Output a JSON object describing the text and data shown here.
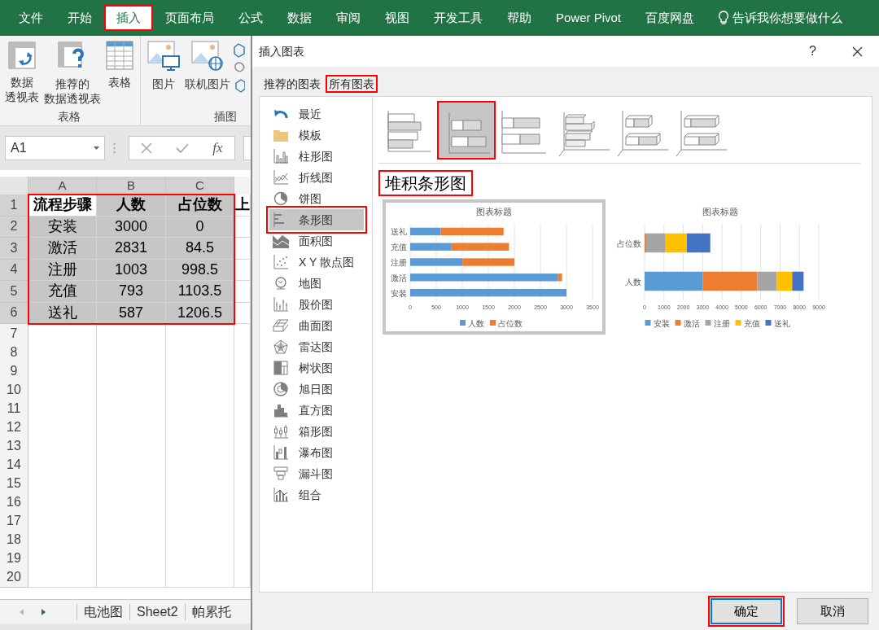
{
  "menu_tabs": [
    {
      "label": "文件",
      "selected": false
    },
    {
      "label": "开始",
      "selected": false
    },
    {
      "label": "插入",
      "selected": true
    },
    {
      "label": "页面布局",
      "selected": false
    },
    {
      "label": "公式",
      "selected": false
    },
    {
      "label": "数据",
      "selected": false
    },
    {
      "label": "审阅",
      "selected": false
    },
    {
      "label": "视图",
      "selected": false
    },
    {
      "label": "开发工具",
      "selected": false
    },
    {
      "label": "帮助",
      "selected": false
    },
    {
      "label": "Power Pivot",
      "selected": false
    },
    {
      "label": "百度网盘",
      "selected": false
    }
  ],
  "tell_me": "告诉我你想要做什么",
  "ribbon_groups": [
    {
      "label": "表格",
      "buttons": [
        {
          "lines": [
            "数据",
            "透视表"
          ]
        },
        {
          "lines": [
            "推荐的",
            "数据透视表"
          ]
        },
        {
          "lines": [
            "表格"
          ]
        }
      ]
    },
    {
      "label": "插图",
      "buttons": [
        {
          "lines": [
            "图片"
          ]
        },
        {
          "lines": [
            "联机图片"
          ]
        }
      ]
    }
  ],
  "name_box": "A1",
  "formula_fx": "fx",
  "columns": [
    {
      "label": "A",
      "selected": true
    },
    {
      "label": "B",
      "selected": true
    },
    {
      "label": "C",
      "selected": true
    }
  ],
  "rows": [
    {
      "number": "1",
      "selected": true,
      "header": true,
      "cells": [
        {
          "text": "流程步骤",
          "selected": false
        },
        {
          "text": "人数",
          "selected": true
        },
        {
          "text": "占位数",
          "selected": true
        },
        {
          "text": "上",
          "selected": false
        }
      ]
    },
    {
      "number": "2",
      "selected": true,
      "header": false,
      "cells": [
        {
          "text": "安装",
          "selected": true
        },
        {
          "text": "3000",
          "selected": true
        },
        {
          "text": "0",
          "selected": true
        }
      ]
    },
    {
      "number": "3",
      "selected": true,
      "header": false,
      "cells": [
        {
          "text": "激活",
          "selected": true
        },
        {
          "text": "2831",
          "selected": true
        },
        {
          "text": "84.5",
          "selected": true
        }
      ]
    },
    {
      "number": "4",
      "selected": true,
      "header": false,
      "cells": [
        {
          "text": "注册",
          "selected": true
        },
        {
          "text": "1003",
          "selected": true
        },
        {
          "text": "998.5",
          "selected": true
        }
      ]
    },
    {
      "number": "5",
      "selected": true,
      "header": false,
      "cells": [
        {
          "text": "充值",
          "selected": true
        },
        {
          "text": "793",
          "selected": true
        },
        {
          "text": "1103.5",
          "selected": true
        }
      ]
    },
    {
      "number": "6",
      "selected": true,
      "header": false,
      "cells": [
        {
          "text": "送礼",
          "selected": true
        },
        {
          "text": "587",
          "selected": true
        },
        {
          "text": "1206.5",
          "selected": true
        }
      ]
    },
    {
      "number": "7",
      "selected": false,
      "cells": []
    },
    {
      "number": "8",
      "selected": false,
      "cells": []
    },
    {
      "number": "9",
      "selected": false,
      "cells": []
    },
    {
      "number": "10",
      "selected": false,
      "cells": []
    },
    {
      "number": "11",
      "selected": false,
      "cells": []
    },
    {
      "number": "12",
      "selected": false,
      "cells": []
    },
    {
      "number": "13",
      "selected": false,
      "cells": []
    },
    {
      "number": "14",
      "selected": false,
      "cells": []
    },
    {
      "number": "15",
      "selected": false,
      "cells": []
    },
    {
      "number": "16",
      "selected": false,
      "cells": []
    },
    {
      "number": "17",
      "selected": false,
      "cells": []
    },
    {
      "number": "18",
      "selected": false,
      "cells": []
    },
    {
      "number": "19",
      "selected": false,
      "cells": []
    },
    {
      "number": "20",
      "selected": false,
      "cells": []
    }
  ],
  "range_highlight": true,
  "sheet_tabs": [
    {
      "label": "电池图"
    },
    {
      "label": "Sheet2"
    },
    {
      "label": "帕累托"
    }
  ],
  "dialog": {
    "title": "插入图表",
    "help": "?",
    "tabs": [
      {
        "label": "推荐的图表",
        "selected": false
      },
      {
        "label": "所有图表",
        "selected": true
      }
    ],
    "chart_types": [
      {
        "label": "最近",
        "selected": false
      },
      {
        "label": "模板",
        "selected": false
      },
      {
        "label": "柱形图",
        "selected": false
      },
      {
        "label": "折线图",
        "selected": false
      },
      {
        "label": "饼图",
        "selected": false
      },
      {
        "label": "条形图",
        "selected": true
      },
      {
        "label": "面积图",
        "selected": false
      },
      {
        "label": "X Y 散点图",
        "selected": false
      },
      {
        "label": "地图",
        "selected": false
      },
      {
        "label": "股价图",
        "selected": false
      },
      {
        "label": "曲面图",
        "selected": false
      },
      {
        "label": "雷达图",
        "selected": false
      },
      {
        "label": "树状图",
        "selected": false
      },
      {
        "label": "旭日图",
        "selected": false
      },
      {
        "label": "直方图",
        "selected": false
      },
      {
        "label": "箱形图",
        "selected": false
      },
      {
        "label": "瀑布图",
        "selected": false
      },
      {
        "label": "漏斗图",
        "selected": false
      },
      {
        "label": "组合",
        "selected": false
      }
    ],
    "subtypes": [
      {
        "selected": false
      },
      {
        "selected": true
      },
      {
        "selected": false
      },
      {
        "selected": false
      },
      {
        "selected": false
      },
      {
        "selected": false
      }
    ],
    "subtype_title": "堆积条形图",
    "subtype_title_highlight": true,
    "previews": [
      {
        "selected": true,
        "chart_data": {
          "type": "bar",
          "orientation": "horizontal",
          "stacked": true,
          "title": "图表标题",
          "categories": [
            "送礼",
            "充值",
            "注册",
            "激活",
            "安装"
          ],
          "series": [
            {
              "name": "人数",
              "color": "#5b9bd5",
              "values": [
                587,
                793,
                1003,
                2831,
                3000
              ]
            },
            {
              "name": "占位数",
              "color": "#ed7d31",
              "values": [
                1206.5,
                1103.5,
                998.5,
                84.5,
                0
              ]
            }
          ],
          "grid": true,
          "legend": true,
          "xlim": [
            0,
            3500
          ],
          "xticks": [
            0,
            500,
            1000,
            1500,
            2000,
            2500,
            3000,
            3500
          ]
        }
      },
      {
        "selected": false,
        "chart_data": {
          "type": "bar",
          "orientation": "horizontal",
          "stacked": true,
          "title": "图表标题",
          "categories": [
            "占位数",
            "人数"
          ],
          "series": [
            {
              "name": "安装",
              "color": "#5b9bd5",
              "values": [
                0,
                3000
              ]
            },
            {
              "name": "激活",
              "color": "#ed7d31",
              "values": [
                84.5,
                2831
              ]
            },
            {
              "name": "注册",
              "color": "#a5a5a5",
              "values": [
                998.5,
                1003
              ]
            },
            {
              "name": "充值",
              "color": "#ffc000",
              "values": [
                1103.5,
                793
              ]
            },
            {
              "name": "送礼",
              "color": "#4472c4",
              "values": [
                1206.5,
                587
              ]
            }
          ],
          "grid": true,
          "legend": true,
          "xlim": [
            0,
            9000
          ],
          "xticks": [
            0,
            1000,
            2000,
            3000,
            4000,
            5000,
            6000,
            7000,
            8000,
            9000
          ]
        }
      }
    ],
    "buttons": [
      {
        "label": "确定",
        "kind": "primary",
        "highlight": true
      },
      {
        "label": "取消",
        "kind": "secondary",
        "highlight": false
      }
    ]
  }
}
